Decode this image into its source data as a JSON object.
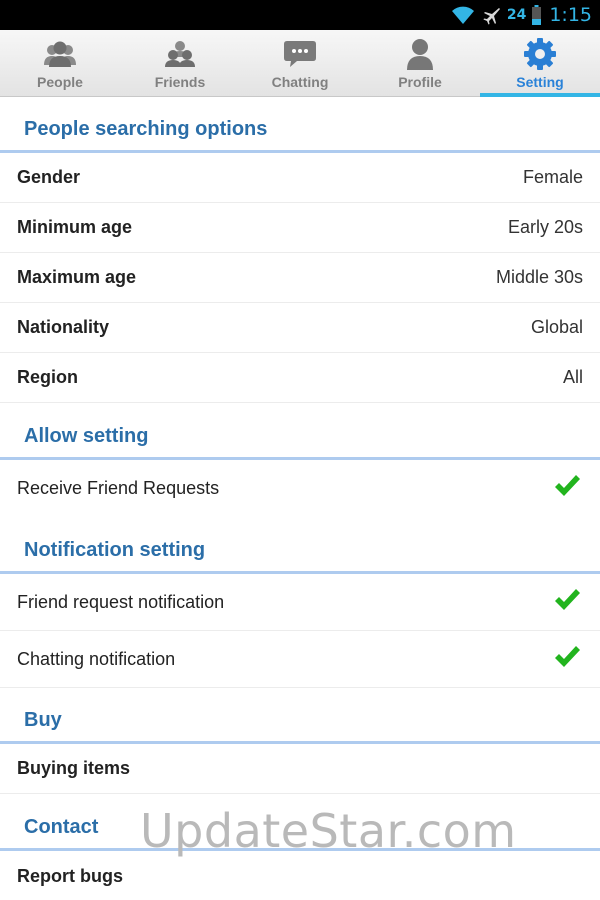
{
  "status_bar": {
    "battery_level": "24",
    "time": "1:15",
    "icons": [
      "wifi-icon",
      "airplane-icon",
      "battery-icon"
    ],
    "color": "#33b5e5"
  },
  "tabs": [
    {
      "label": "People",
      "icon": "people-icon",
      "active": false
    },
    {
      "label": "Friends",
      "icon": "friends-icon",
      "active": false
    },
    {
      "label": "Chatting",
      "icon": "chat-bubble-icon",
      "active": false
    },
    {
      "label": "Profile",
      "icon": "profile-icon",
      "active": false
    },
    {
      "label": "Setting",
      "icon": "gear-icon",
      "active": true
    }
  ],
  "sections": {
    "search": {
      "title": "People searching options",
      "rows": [
        {
          "label": "Gender",
          "value": "Female"
        },
        {
          "label": "Minimum age",
          "value": "Early 20s"
        },
        {
          "label": "Maximum age",
          "value": "Middle 30s"
        },
        {
          "label": "Nationality",
          "value": "Global"
        },
        {
          "label": "Region",
          "value": "All"
        }
      ]
    },
    "allow": {
      "title": "Allow setting",
      "rows": [
        {
          "label": "Receive Friend Requests",
          "checked": true
        }
      ]
    },
    "notification": {
      "title": "Notification setting",
      "rows": [
        {
          "label": "Friend request notification",
          "checked": true
        },
        {
          "label": "Chatting notification",
          "checked": true
        }
      ]
    },
    "buy": {
      "title": "Buy",
      "rows": [
        {
          "label": "Buying items"
        }
      ]
    },
    "contact": {
      "title": "Contact",
      "rows": [
        {
          "label": "Report bugs"
        }
      ]
    }
  },
  "watermark": "UpdateStar.com",
  "colors": {
    "section_title": "#2b6ea8",
    "section_rule": "#aecbef",
    "active_tab": "#2a82d8",
    "check": "#22b41e"
  }
}
